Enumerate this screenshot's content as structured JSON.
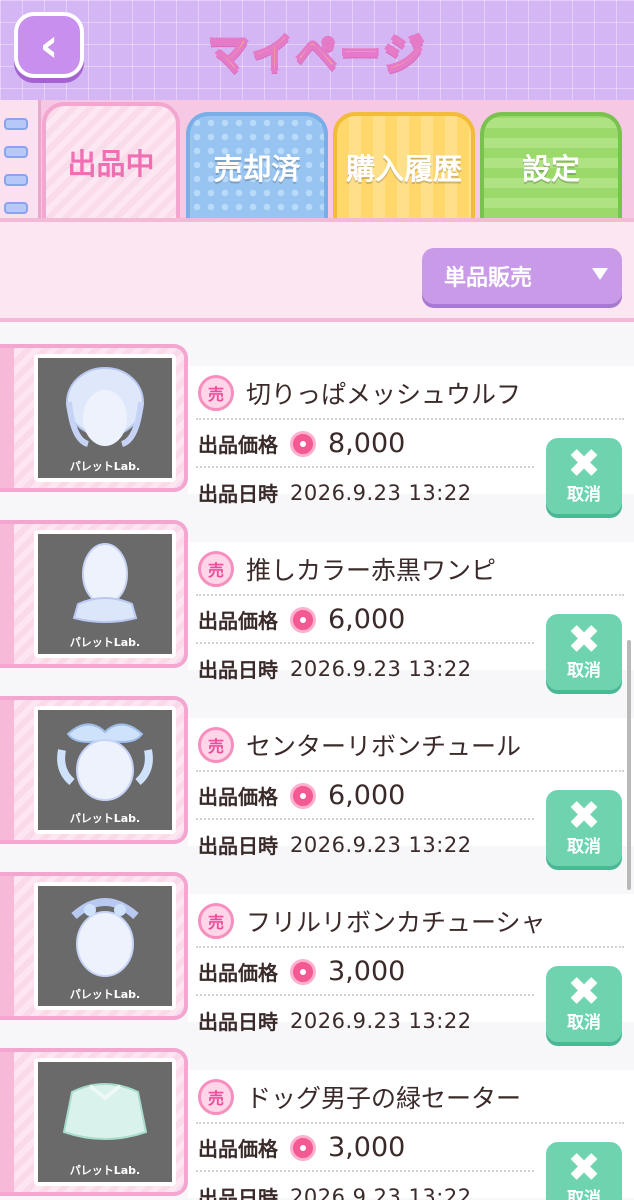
{
  "header": {
    "title": "マイページ",
    "back_icon": "chevron-left-icon"
  },
  "tabs": [
    {
      "label": "出品中",
      "active": true
    },
    {
      "label": "売却済",
      "active": false
    },
    {
      "label": "購入履歴",
      "active": false
    },
    {
      "label": "設定",
      "active": false
    }
  ],
  "filter": {
    "selected": "単品販売"
  },
  "list": {
    "price_label": "出品価格",
    "date_label": "出品日時",
    "cancel_label": "取消",
    "brand": "パレットLab.",
    "items": [
      {
        "name": "切りっぱメッシュウルフ",
        "price": "8,000",
        "date": "2026.9.23 13:22"
      },
      {
        "name": "推しカラー赤黒ワンピ",
        "price": "6,000",
        "date": "2026.9.23 13:22"
      },
      {
        "name": "センターリボンチュール",
        "price": "6,000",
        "date": "2026.9.23 13:22"
      },
      {
        "name": "フリルリボンカチューシャ",
        "price": "3,000",
        "date": "2026.9.23 13:22"
      },
      {
        "name": "ドッグ男子の緑セーター",
        "price": "3,000",
        "date": "2026.9.23 13:22"
      }
    ]
  },
  "colors": {
    "accent": "#f06fb3",
    "header": "#d5b6f4",
    "cancel": "#6fd3b0",
    "dropdown": "#c99ae8"
  }
}
